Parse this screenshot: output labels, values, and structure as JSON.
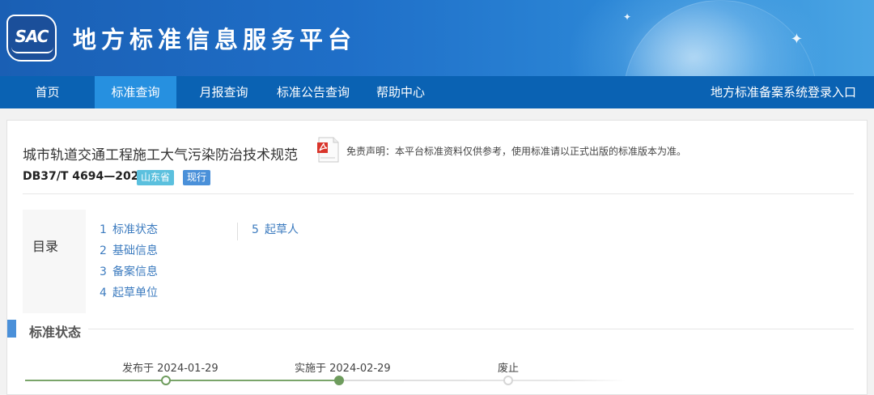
{
  "header": {
    "logo_text": "SAC",
    "site_title": "地方标准信息服务平台"
  },
  "nav": {
    "items": [
      {
        "label": "首页",
        "active": false
      },
      {
        "label": "标准查询",
        "active": true
      },
      {
        "label": "月报查询",
        "active": false
      },
      {
        "label": "标准公告查询",
        "active": false
      },
      {
        "label": "帮助中心",
        "active": false
      }
    ],
    "login_link": "地方标准备案系统登录入口"
  },
  "document": {
    "title": "城市轨道交通工程施工大气污染防治技术规范",
    "disclaimer": "免责声明：本平台标准资料仅供参考，使用标准请以正式出版的标准版本为准。",
    "standard_number": "DB37/T 4694—2024",
    "province_badge": "山东省",
    "status_badge": "现行"
  },
  "toc": {
    "label": "目录",
    "items": [
      {
        "num": "1",
        "label": "标准状态"
      },
      {
        "num": "2",
        "label": "基础信息"
      },
      {
        "num": "3",
        "label": "备案信息"
      },
      {
        "num": "4",
        "label": "起草单位"
      },
      {
        "num": "5",
        "label": "起草人"
      }
    ]
  },
  "status_section": {
    "title": "标准状态",
    "timeline": [
      {
        "label": "发布于 2024-01-29",
        "state": "done"
      },
      {
        "label": "实施于 2024-02-29",
        "state": "current"
      },
      {
        "label": "废止",
        "state": "pending"
      }
    ]
  },
  "colors": {
    "nav_bg": "#0a62b3",
    "nav_active": "#2690e0",
    "link": "#3c7bbf",
    "timeline_done": "#6e9c5d",
    "badge_province": "#5bc0de",
    "badge_status": "#4a90d9"
  },
  "icons": {
    "pdf": "pdf-file-icon"
  }
}
